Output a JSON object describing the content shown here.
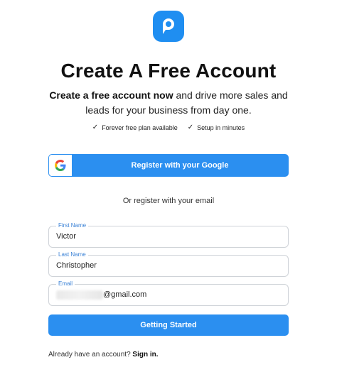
{
  "header": {
    "title": "Create A Free Account",
    "subtitle_bold": "Create a free account now",
    "subtitle_rest": "and drive more sales and leads for your business from day one."
  },
  "features": [
    {
      "icon": "check-icon",
      "label": "Forever free plan available"
    },
    {
      "icon": "check-icon",
      "label": "Setup in minutes"
    }
  ],
  "google_button": {
    "label": "Register with your Google"
  },
  "divider": {
    "text": "Or register with your email"
  },
  "form": {
    "first_name": {
      "label": "First Name",
      "value": "Victor"
    },
    "last_name": {
      "label": "Last Name",
      "value": "Christopher"
    },
    "email": {
      "label": "Email",
      "value": "@gmail.com"
    }
  },
  "submit": {
    "label": "Getting Started"
  },
  "footer": {
    "prompt": "Already have an account?",
    "link": "Sign in."
  },
  "colors": {
    "accent": "#2b8ff0",
    "field_label": "#3b82d6",
    "border": "#cfd3d8"
  }
}
